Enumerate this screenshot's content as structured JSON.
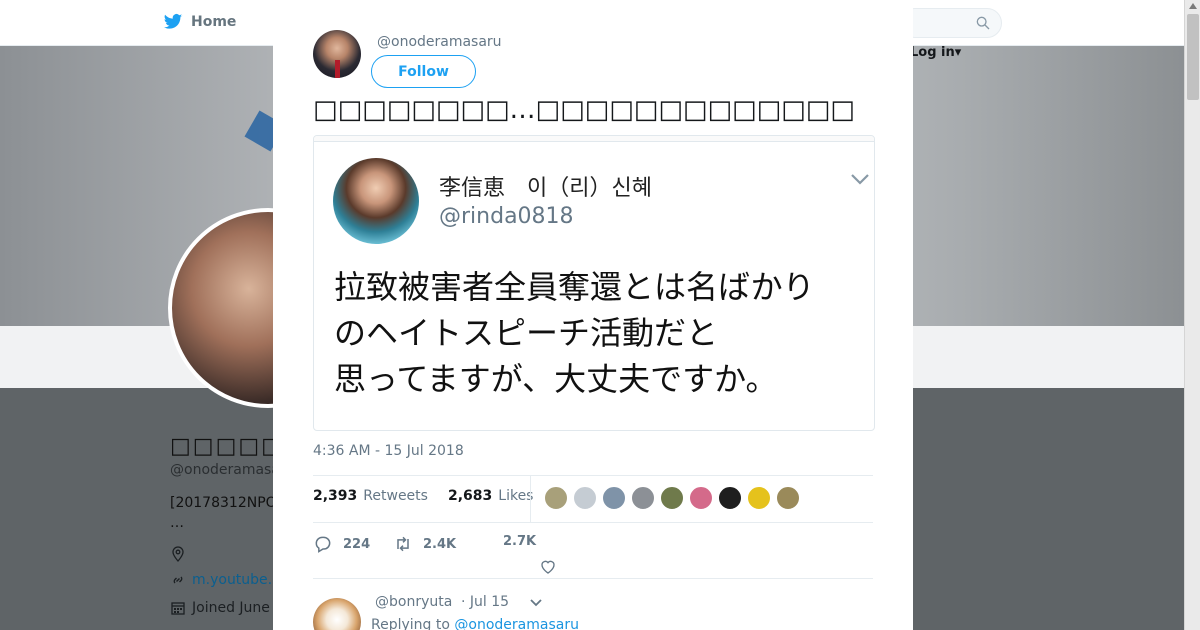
{
  "background": {
    "nav": {
      "home_label": "Home",
      "login_label": "Log in▾"
    },
    "profile": {
      "name": "□□□□□□",
      "handle": "@onoderamasa",
      "bio_line1": "[20178312NPO",
      "bio_line2": "…",
      "website": "m.youtube.",
      "joined": "Joined June"
    }
  },
  "modal": {
    "author_handle": "@onoderamasaru",
    "follow_label": "Follow",
    "tweet_text": "□□□□□□□□…□□□□□□□□□□□□□",
    "quoted": {
      "name": "李信恵　이（리）신혜",
      "handle": "@rinda0818",
      "text_line1": "拉致被害者全員奪還とは名ばかり",
      "text_line2": "のヘイトスピーチ活動だと",
      "text_line3": "思ってますが、大丈夫ですか。"
    },
    "timestamp": "4:36 AM - 15 Jul 2018",
    "stats": {
      "retweets_count": "2,393",
      "retweets_label": "Retweets",
      "likes_count": "2,683",
      "likes_label": "Likes"
    },
    "liker_colors": [
      "#a8a07a",
      "#c5ccd3",
      "#7f93a8",
      "#8c9096",
      "#6f7a4b",
      "#d46a8a",
      "#1e1e1e",
      "#e5c21c",
      "#9a8a5a"
    ],
    "actions": {
      "replies": "224",
      "retweets": "2.4K",
      "likes": "2.7K"
    },
    "reply": {
      "handle": "@bonryuta",
      "date": "· Jul 15",
      "replying_prefix": "Replying to",
      "replying_to": "@onoderamasaru"
    }
  },
  "colors": {
    "accent": "#1da1f2",
    "link": "#1b95e0",
    "muted": "#657786"
  }
}
